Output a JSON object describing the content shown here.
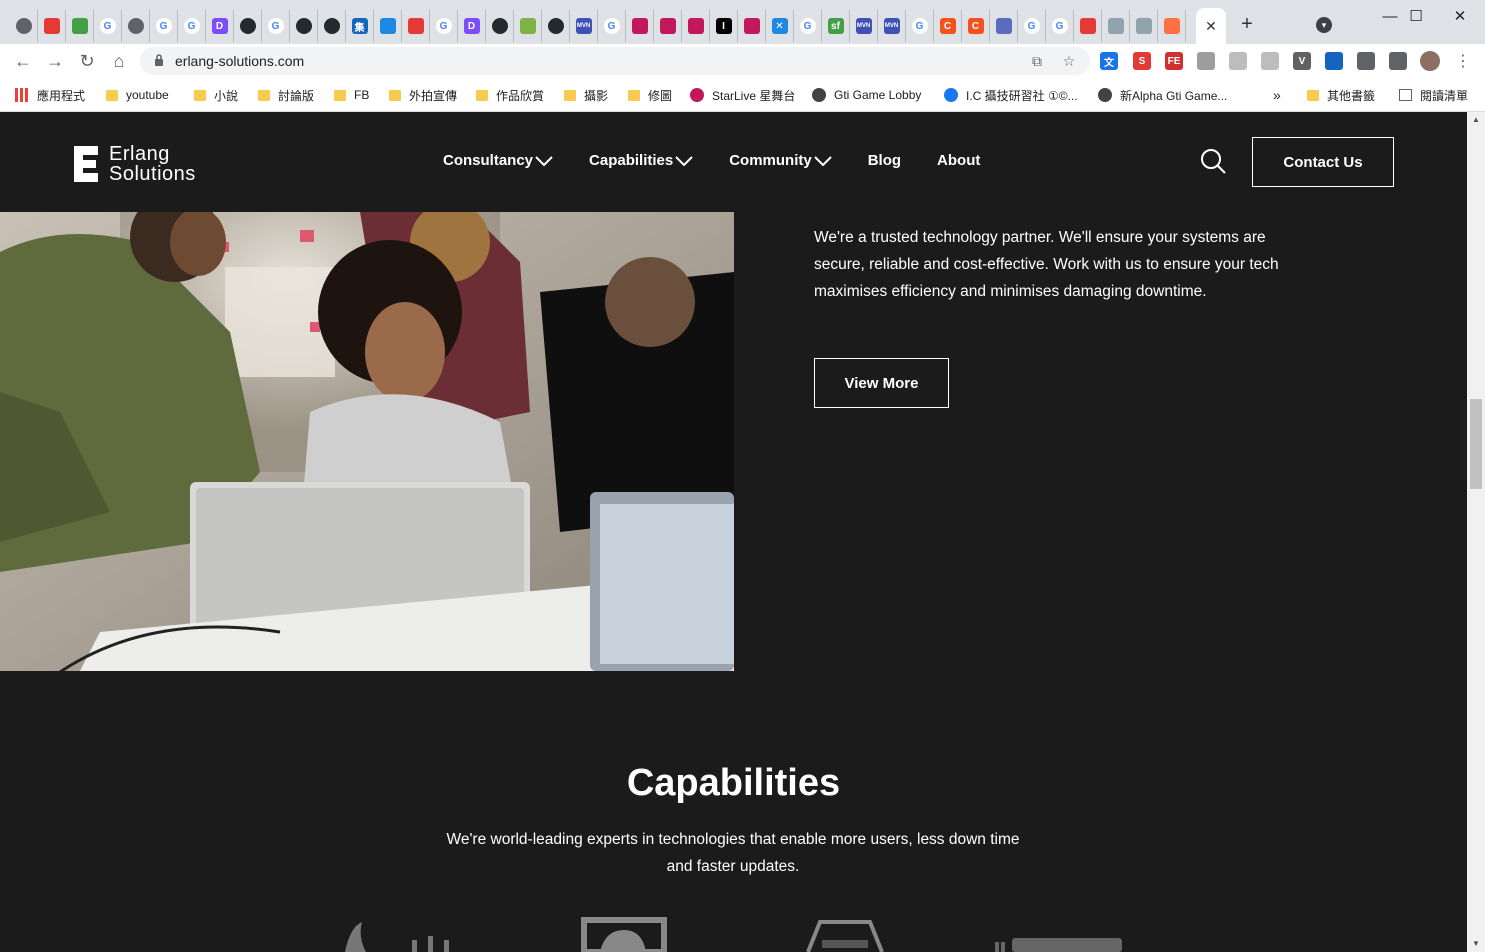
{
  "browser": {
    "active_tab_close": "✕",
    "new_tab": "+",
    "url": "erlang-solutions.com",
    "window_controls": [
      "—",
      "☐",
      "✕"
    ],
    "tab_favicons": [
      {
        "icon": "globe-icon",
        "color": "#5f6368",
        "glyph": ""
      },
      {
        "icon": "pen-icon",
        "color": "#e53935",
        "glyph": ""
      },
      {
        "icon": "green-badge-icon",
        "color": "#43a047",
        "glyph": ""
      },
      {
        "icon": "google-icon",
        "color": "#4285f4",
        "glyph": "G"
      },
      {
        "icon": "globe-icon",
        "color": "#5f6368",
        "glyph": ""
      },
      {
        "icon": "google-icon",
        "color": "#4285f4",
        "glyph": "G"
      },
      {
        "icon": "google-icon",
        "color": "#4285f4",
        "glyph": "G"
      },
      {
        "icon": "purple-d-icon",
        "color": "#7c4dff",
        "glyph": "D"
      },
      {
        "icon": "github-icon",
        "color": "#24292e",
        "glyph": ""
      },
      {
        "icon": "google-icon",
        "color": "#4285f4",
        "glyph": "G"
      },
      {
        "icon": "github-icon",
        "color": "#24292e",
        "glyph": ""
      },
      {
        "icon": "github-icon",
        "color": "#24292e",
        "glyph": ""
      },
      {
        "icon": "blue-square-icon",
        "color": "#1565c0",
        "glyph": "集"
      },
      {
        "icon": "wiki-icon",
        "color": "#1e88e5",
        "glyph": ""
      },
      {
        "icon": "pen-icon",
        "color": "#e53935",
        "glyph": ""
      },
      {
        "icon": "google-icon",
        "color": "#4285f4",
        "glyph": "G"
      },
      {
        "icon": "purple-d-icon",
        "color": "#7c4dff",
        "glyph": "D"
      },
      {
        "icon": "github-icon",
        "color": "#24292e",
        "glyph": ""
      },
      {
        "icon": "leaf-icon",
        "color": "#7cb342",
        "glyph": ""
      },
      {
        "icon": "github-icon",
        "color": "#24292e",
        "glyph": ""
      },
      {
        "icon": "mvn-icon",
        "color": "#3f51b5",
        "glyph": "MVN"
      },
      {
        "icon": "google-icon",
        "color": "#4285f4",
        "glyph": "G"
      },
      {
        "icon": "feather-icon",
        "color": "#c2185b",
        "glyph": ""
      },
      {
        "icon": "feather-icon",
        "color": "#c2185b",
        "glyph": ""
      },
      {
        "icon": "feather-icon",
        "color": "#c2185b",
        "glyph": ""
      },
      {
        "icon": "intellij-icon",
        "color": "#000000",
        "glyph": "I"
      },
      {
        "icon": "feather-icon",
        "color": "#c2185b",
        "glyph": ""
      },
      {
        "icon": "confluence-icon",
        "color": "#1e88e5",
        "glyph": "✕"
      },
      {
        "icon": "google-icon",
        "color": "#4285f4",
        "glyph": "G"
      },
      {
        "icon": "sf-icon",
        "color": "#43a047",
        "glyph": "sf"
      },
      {
        "icon": "mvn-icon",
        "color": "#3f51b5",
        "glyph": "MVN"
      },
      {
        "icon": "mvn-icon",
        "color": "#3f51b5",
        "glyph": "MVN"
      },
      {
        "icon": "google-icon",
        "color": "#4285f4",
        "glyph": "G"
      },
      {
        "icon": "c-icon",
        "color": "#f4511e",
        "glyph": "C"
      },
      {
        "icon": "c-icon",
        "color": "#f4511e",
        "glyph": "C"
      },
      {
        "icon": "frame-icon",
        "color": "#5c6bc0",
        "glyph": ""
      },
      {
        "icon": "google-icon",
        "color": "#4285f4",
        "glyph": "G"
      },
      {
        "icon": "google-icon",
        "color": "#4285f4",
        "glyph": "G"
      },
      {
        "icon": "huawei-icon",
        "color": "#e53935",
        "glyph": ""
      },
      {
        "icon": "diamond-icon",
        "color": "#90a4ae",
        "glyph": ""
      },
      {
        "icon": "diamond-icon",
        "color": "#90a4ae",
        "glyph": ""
      },
      {
        "icon": "orange-icon",
        "color": "#ff7043",
        "glyph": ""
      }
    ],
    "extensions": [
      {
        "icon": "translate-icon",
        "color": "#1a73e8",
        "glyph": "文"
      },
      {
        "icon": "s-icon",
        "color": "#e53935",
        "glyph": "S"
      },
      {
        "icon": "fe-icon",
        "color": "#d32f2f",
        "glyph": "FE"
      },
      {
        "icon": "cloud-icon",
        "color": "#9e9e9e",
        "glyph": ""
      },
      {
        "icon": "grid-ext-icon",
        "color": "#bdbdbd",
        "glyph": ""
      },
      {
        "icon": "clock-ext-icon",
        "color": "#bdbdbd",
        "glyph": ""
      },
      {
        "icon": "vue-icon",
        "color": "#616161",
        "glyph": "V"
      },
      {
        "icon": "heart-pin-icon",
        "color": "#1565c0",
        "glyph": ""
      },
      {
        "icon": "puzzle-icon",
        "color": "#5f6368",
        "glyph": ""
      },
      {
        "icon": "playlist-icon",
        "color": "#5f6368",
        "glyph": ""
      }
    ],
    "bookmarks": [
      {
        "label": "應用程式",
        "kind": "apps"
      },
      {
        "label": "youtube",
        "kind": "folder"
      },
      {
        "label": "小說",
        "kind": "folder"
      },
      {
        "label": "討論版",
        "kind": "folder"
      },
      {
        "label": "FB",
        "kind": "folder"
      },
      {
        "label": "外拍宣傳",
        "kind": "folder"
      },
      {
        "label": "作品欣賞",
        "kind": "folder"
      },
      {
        "label": "攝影",
        "kind": "folder"
      },
      {
        "label": "修圖",
        "kind": "folder"
      },
      {
        "label": "StarLive 星舞台",
        "kind": "site",
        "color": "#c2185b"
      },
      {
        "label": "Gti Game Lobby",
        "kind": "site",
        "color": "#424242"
      },
      {
        "label": "I.C 攝技研習社 ①©...",
        "kind": "site",
        "color": "#1877f2"
      },
      {
        "label": "新Alpha Gti Game...",
        "kind": "site",
        "color": "#424242"
      }
    ],
    "bookmark_overflow": "»",
    "other_bookmarks": "其他書籤",
    "reading_list": "閱讀清單"
  },
  "site": {
    "logo_line1": "Erlang",
    "logo_line2": "Solutions",
    "nav": [
      {
        "label": "Consultancy",
        "has_dropdown": true
      },
      {
        "label": "Capabilities",
        "has_dropdown": true
      },
      {
        "label": "Community",
        "has_dropdown": true
      },
      {
        "label": "Blog",
        "has_dropdown": false
      },
      {
        "label": "About",
        "has_dropdown": false
      }
    ],
    "contact_label": "Contact Us",
    "hero_text": "We're a trusted technology partner. We'll ensure your systems are secure, reliable and cost-effective. Work with us to ensure your tech maximises efficiency and minimises damaging downtime.",
    "view_more_label": "View More",
    "capabilities_title": "Capabilities",
    "capabilities_desc": "We're world-leading experts in technologies that enable more users, less down time and faster updates.",
    "tech_logos": [
      "elixir-logo",
      "erlang-logo",
      "emq-logo",
      "rabbitmq-logo"
    ]
  }
}
